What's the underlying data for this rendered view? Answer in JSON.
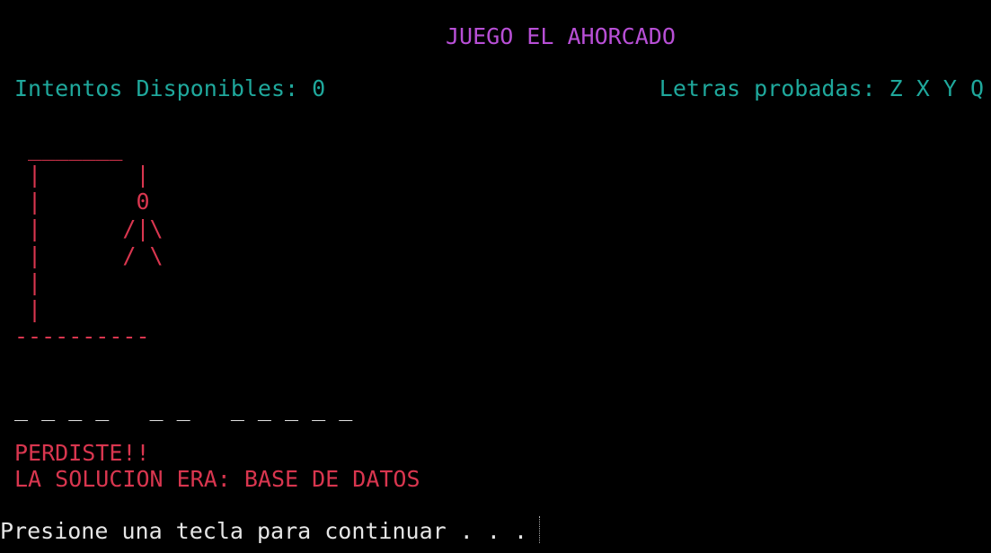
{
  "header": {
    "title": "JUEGO EL AHORCADO",
    "tries_label": "Intentos Disponibles: 0",
    "letters_label": "Letras probadas: Z X Y Q"
  },
  "gallows": {
    "art": " _______\n |       |\n |       0\n |      /|\\\n |      / \\\n |\n |\n----------"
  },
  "word": {
    "blanks": "_ _ _ _   _ _   _ _ _ _ _"
  },
  "result": {
    "lost_text": "PERDISTE!!",
    "solution_text": "LA SOLUCION ERA: BASE DE DATOS"
  },
  "footer": {
    "prompt": "Presione una tecla para continuar . . ."
  },
  "colors": {
    "title": "#b84fd6",
    "info": "#1fa89c",
    "hangman": "#d9364f",
    "text": "#e6e6e6",
    "background": "#000000"
  }
}
